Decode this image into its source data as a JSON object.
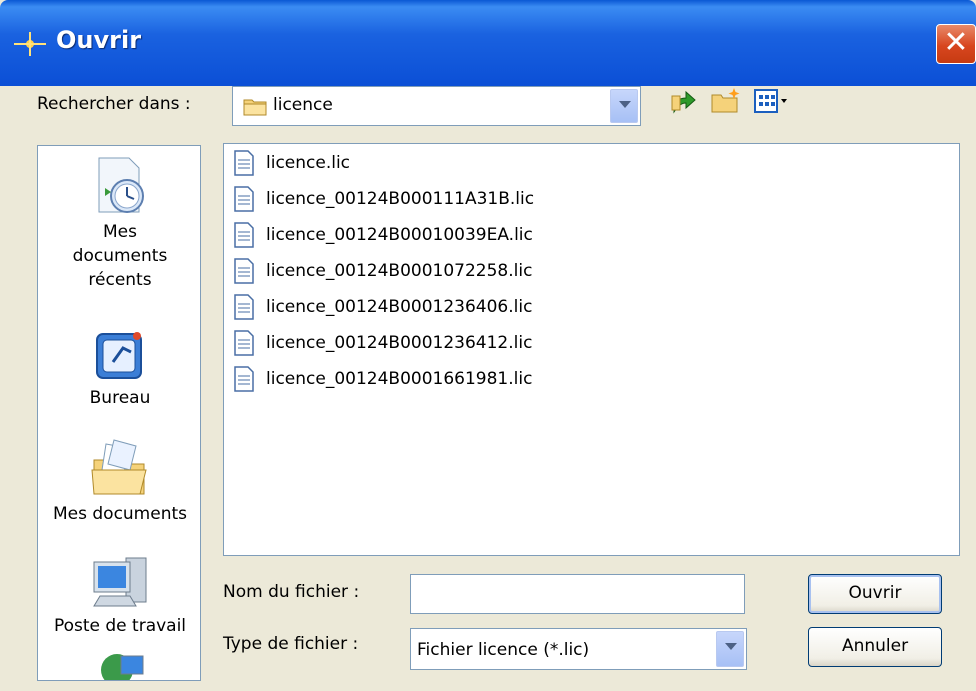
{
  "window": {
    "title": "Ouvrir",
    "close_symbol": "✕"
  },
  "toolbar": {
    "lookin_label": "Rechercher dans :",
    "lookin_value": "licence",
    "icons": [
      "back-up-folder-icon",
      "new-folder-icon",
      "view-menu-icon"
    ]
  },
  "places": [
    {
      "label": "Mes documents récents",
      "icon": "recent-documents-icon"
    },
    {
      "label": "Bureau",
      "icon": "desktop-icon"
    },
    {
      "label": "Mes documents",
      "icon": "my-documents-icon"
    },
    {
      "label": "Poste de travail",
      "icon": "my-computer-icon"
    },
    {
      "label": "",
      "icon": "network-places-icon"
    }
  ],
  "files": [
    "licence.lic",
    "licence_00124B000111A31B.lic",
    "licence_00124B00010039EA.lic",
    "licence_00124B0001072258.lic",
    "licence_00124B0001236406.lic",
    "licence_00124B0001236412.lic",
    "licence_00124B0001661981.lic"
  ],
  "form": {
    "filename_label": "Nom du fichier :",
    "filename_value": "",
    "filetype_label": "Type de fichier :",
    "filetype_value": "Fichier licence (*.lic)"
  },
  "buttons": {
    "open": "Ouvrir",
    "cancel": "Annuler"
  }
}
